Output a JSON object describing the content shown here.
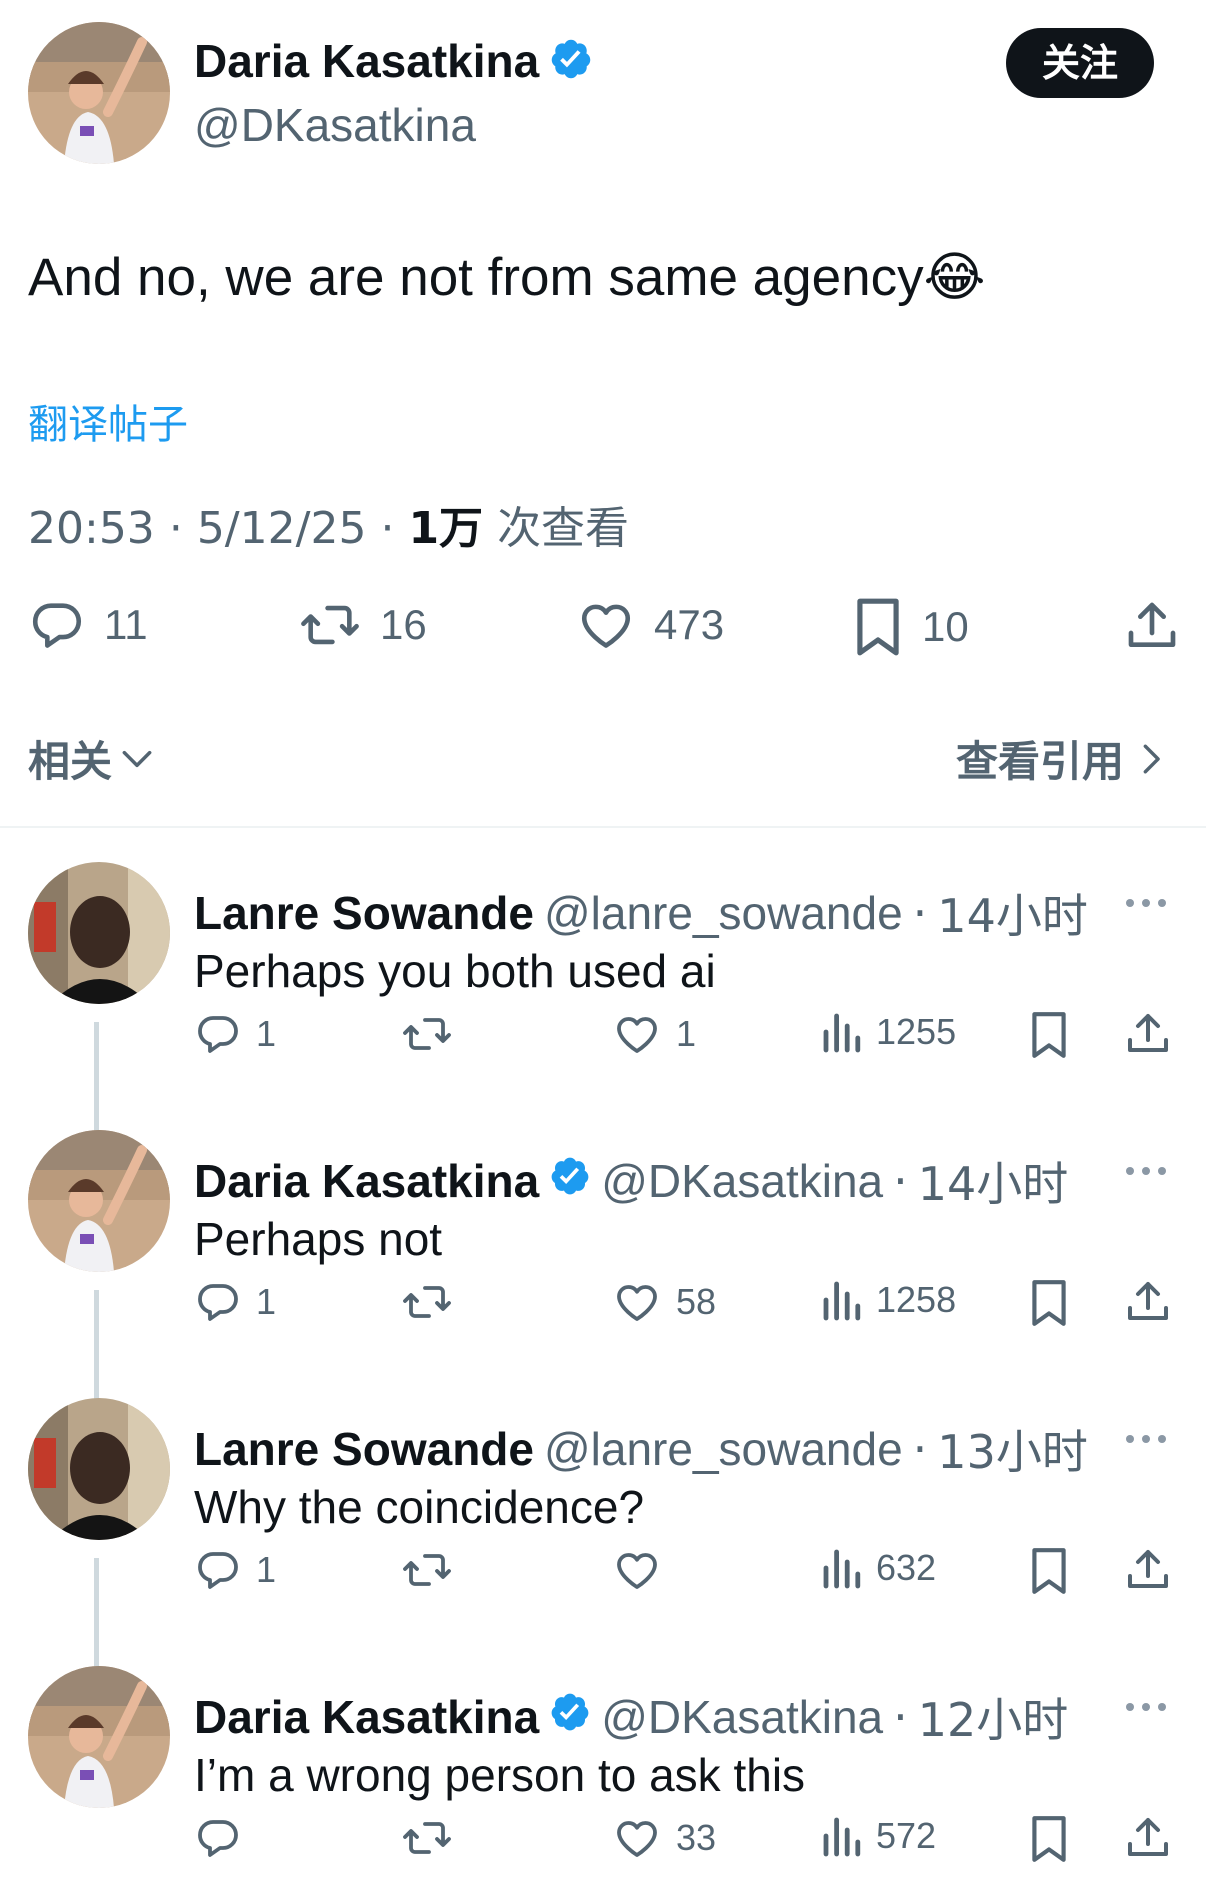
{
  "tweet": {
    "author_name": "Daria Kasatkina",
    "author_handle": "@DKasatkina",
    "follow_label": "关注",
    "text": "And no, we are not from same agency😂",
    "translate_label": "翻译帖子",
    "time": "20:53",
    "date": "5/12/25",
    "views_count": "1万",
    "views_label": "次查看",
    "separator": "·",
    "replies": "11",
    "reposts": "16",
    "likes": "473",
    "bookmarks": "10"
  },
  "section": {
    "related_label": "相关",
    "quotes_label": "查看引用"
  },
  "replies": [
    {
      "name": "Lanre Sowande",
      "handle": "@lanre_sowande",
      "time": "14小时",
      "text": "Perhaps you both used ai",
      "replies": "1",
      "reposts": "",
      "likes": "1",
      "views": "1255",
      "verified": false
    },
    {
      "name": "Daria Kasatkina",
      "handle": "@DKasatkina",
      "time": "14小时",
      "text": "Perhaps not",
      "replies": "1",
      "reposts": "",
      "likes": "58",
      "views": "1258",
      "verified": true
    },
    {
      "name": "Lanre Sowande",
      "handle": "@lanre_sowande",
      "time": "13小时",
      "text": "Why the coincidence?",
      "replies": "1",
      "reposts": "",
      "likes": "",
      "views": "632",
      "verified": false
    },
    {
      "name": "Daria Kasatkina",
      "handle": "@DKasatkina",
      "time": "12小时",
      "text": "I’m a wrong person to ask this",
      "replies": "",
      "reposts": "",
      "likes": "33",
      "views": "572",
      "verified": true
    }
  ],
  "colors": {
    "text": "#0f1419",
    "muted": "#536471",
    "link": "#1d9bf0",
    "verified": "#1d9bf0",
    "button_bg": "#0f1419",
    "divider": "#eff3f4"
  },
  "icons": [
    "reply-icon",
    "repost-icon",
    "like-icon",
    "bookmark-icon",
    "share-icon",
    "views-icon",
    "more-icon",
    "verified-badge-icon",
    "chevron-down-icon",
    "chevron-right-icon"
  ]
}
